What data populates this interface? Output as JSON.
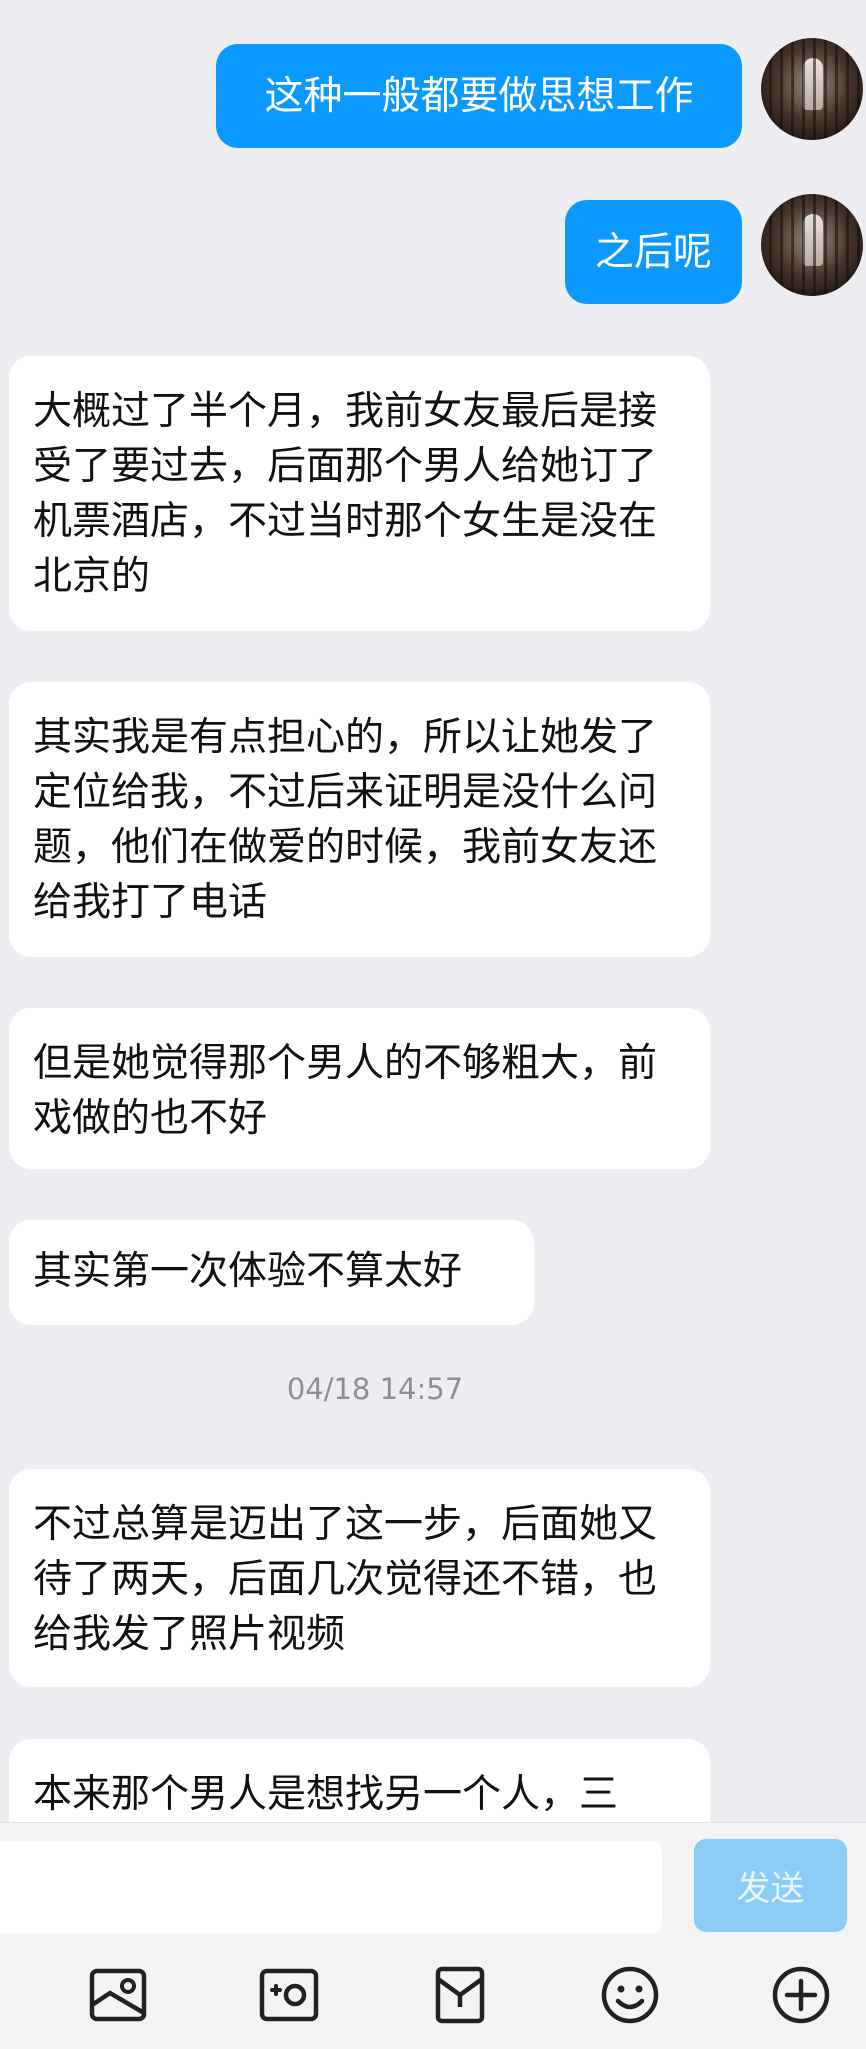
{
  "messages": [
    {
      "direction": "out",
      "text": "这种一般都要做思想工作"
    },
    {
      "direction": "out",
      "text": "之后呢"
    },
    {
      "direction": "in",
      "text": "大概过了半个月，我前女友最后是接受了要过去，后面那个男人给她订了机票酒店，不过当时那个女生是没在北京的"
    },
    {
      "direction": "in",
      "text": "其实我是有点担心的，所以让她发了定位给我，不过后来证明是没什么问题，他们在做爱的时候，我前女友还给我打了电话"
    },
    {
      "direction": "in",
      "text": "但是她觉得那个男人的不够粗大，前戏做的也不好"
    },
    {
      "direction": "in",
      "text": "其实第一次体验不算太好"
    },
    {
      "direction": "in",
      "text": "不过总算是迈出了这一步，后面她又待了两天，后面几次觉得还不错，也给我发了照片视频"
    },
    {
      "direction": "in",
      "text": "本来那个男人是想找另一个人，三"
    }
  ],
  "timestamp": "04/18 14:57",
  "composer": {
    "placeholder": "",
    "send_label": "发送"
  },
  "toolbar": {
    "icons": [
      "image-icon",
      "camera-icon",
      "shopping-bag-icon",
      "emoji-icon",
      "plus-circle-icon"
    ]
  },
  "colors": {
    "outgoing_bubble": "#0c99ff",
    "incoming_bubble": "#ffffff",
    "background": "#ededf2",
    "send_button": "#8ccdf7"
  }
}
